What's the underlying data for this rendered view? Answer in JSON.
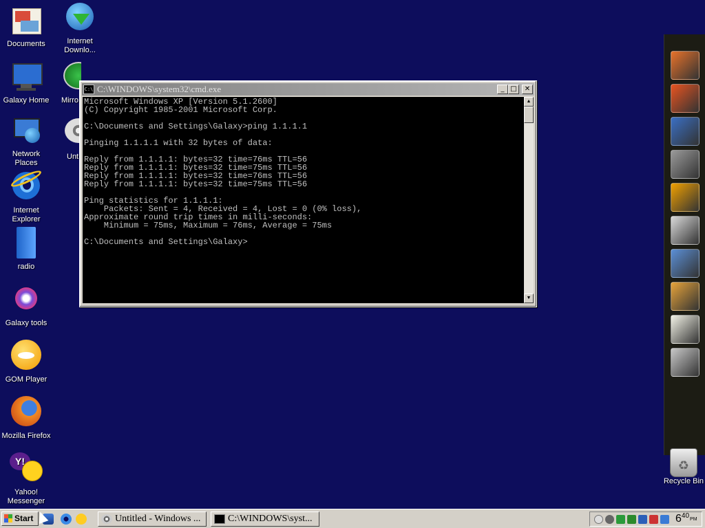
{
  "desktop": {
    "icons": [
      {
        "label": "Documents",
        "icon": "folder-documents-icon"
      },
      {
        "label": "Galaxy Home",
        "icon": "computer-monitor-icon"
      },
      {
        "label": "Network Places",
        "icon": "network-places-icon"
      },
      {
        "label": "Internet Explorer",
        "icon": "internet-explorer-icon"
      },
      {
        "label": "radio",
        "icon": "blue-folder-icon"
      },
      {
        "label": "Galaxy tools",
        "icon": "galaxy-tools-icon"
      },
      {
        "label": "GOM Player",
        "icon": "gom-player-icon"
      },
      {
        "label": "Mozilla Firefox",
        "icon": "firefox-icon"
      },
      {
        "label": "Yahoo! Messenger",
        "icon": "yahoo-messenger-icon"
      },
      {
        "label": "Internet Downlo...",
        "icon": "internet-download-manager-icon"
      },
      {
        "label": "Mirro",
        "icon": "media-player-icon"
      },
      {
        "label": "Unt",
        "icon": "film-reel-icon"
      }
    ],
    "recycle_bin": {
      "label": "Recycle Bin",
      "icon": "recycle-bin-icon"
    }
  },
  "cmd_window": {
    "title": "C:\\WINDOWS\\system32\\cmd.exe",
    "icon_text": "C:\\",
    "buttons": {
      "minimize": "_",
      "maximize": "□",
      "close": "✕"
    },
    "lines": [
      "Microsoft Windows XP [Version 5.1.2600]",
      "(C) Copyright 1985-2001 Microsoft Corp.",
      "",
      "C:\\Documents and Settings\\Galaxy>ping 1.1.1.1",
      "",
      "Pinging 1.1.1.1 with 32 bytes of data:",
      "",
      "Reply from 1.1.1.1: bytes=32 time=76ms TTL=56",
      "Reply from 1.1.1.1: bytes=32 time=75ms TTL=56",
      "Reply from 1.1.1.1: bytes=32 time=76ms TTL=56",
      "Reply from 1.1.1.1: bytes=32 time=75ms TTL=56",
      "",
      "Ping statistics for 1.1.1.1:",
      "    Packets: Sent = 4, Received = 4, Lost = 0 (0% loss),",
      "Approximate round trip times in milli-seconds:",
      "    Minimum = 75ms, Maximum = 76ms, Average = 75ms",
      "",
      "C:\\Documents and Settings\\Galaxy>"
    ],
    "scroll_up": "▲",
    "scroll_down": "▼"
  },
  "dock": {
    "items": [
      {
        "icon": "firefox-icon",
        "color": "#e8722a"
      },
      {
        "icon": "ubuntu-icon",
        "color": "#e95420"
      },
      {
        "icon": "text-editor-icon",
        "color": "#3a6fc4"
      },
      {
        "icon": "settings-gears-icon",
        "color": "#9a9a9a"
      },
      {
        "icon": "users-group-icon",
        "color": "#f0a000"
      },
      {
        "icon": "chrome-icon",
        "color": "#d9d9d9"
      },
      {
        "icon": "itunes-icon",
        "color": "#5b8fd6"
      },
      {
        "icon": "paint-palette-icon",
        "color": "#e6a33a"
      },
      {
        "icon": "notepad-icon",
        "color": "#f2f2e6"
      },
      {
        "icon": "calculator-icon",
        "color": "#c8c8c8"
      }
    ]
  },
  "taskbar": {
    "start_label": "Start",
    "tasks": [
      {
        "label": "Untitled - Windows ...",
        "icon": "movie-maker-icon"
      },
      {
        "label": "C:\\WINDOWS\\syst...",
        "icon": "cmd-icon"
      }
    ],
    "quick_launch": [
      "show-desktop-icon",
      "internet-explorer-icon",
      "messenger-icon"
    ],
    "clock": {
      "hour": "6",
      "minutes": "40",
      "ampm": "PM"
    }
  },
  "colors": {
    "desktop": "#0d0d5c",
    "console_bg": "#000000",
    "console_fg": "#c0c0c0"
  }
}
